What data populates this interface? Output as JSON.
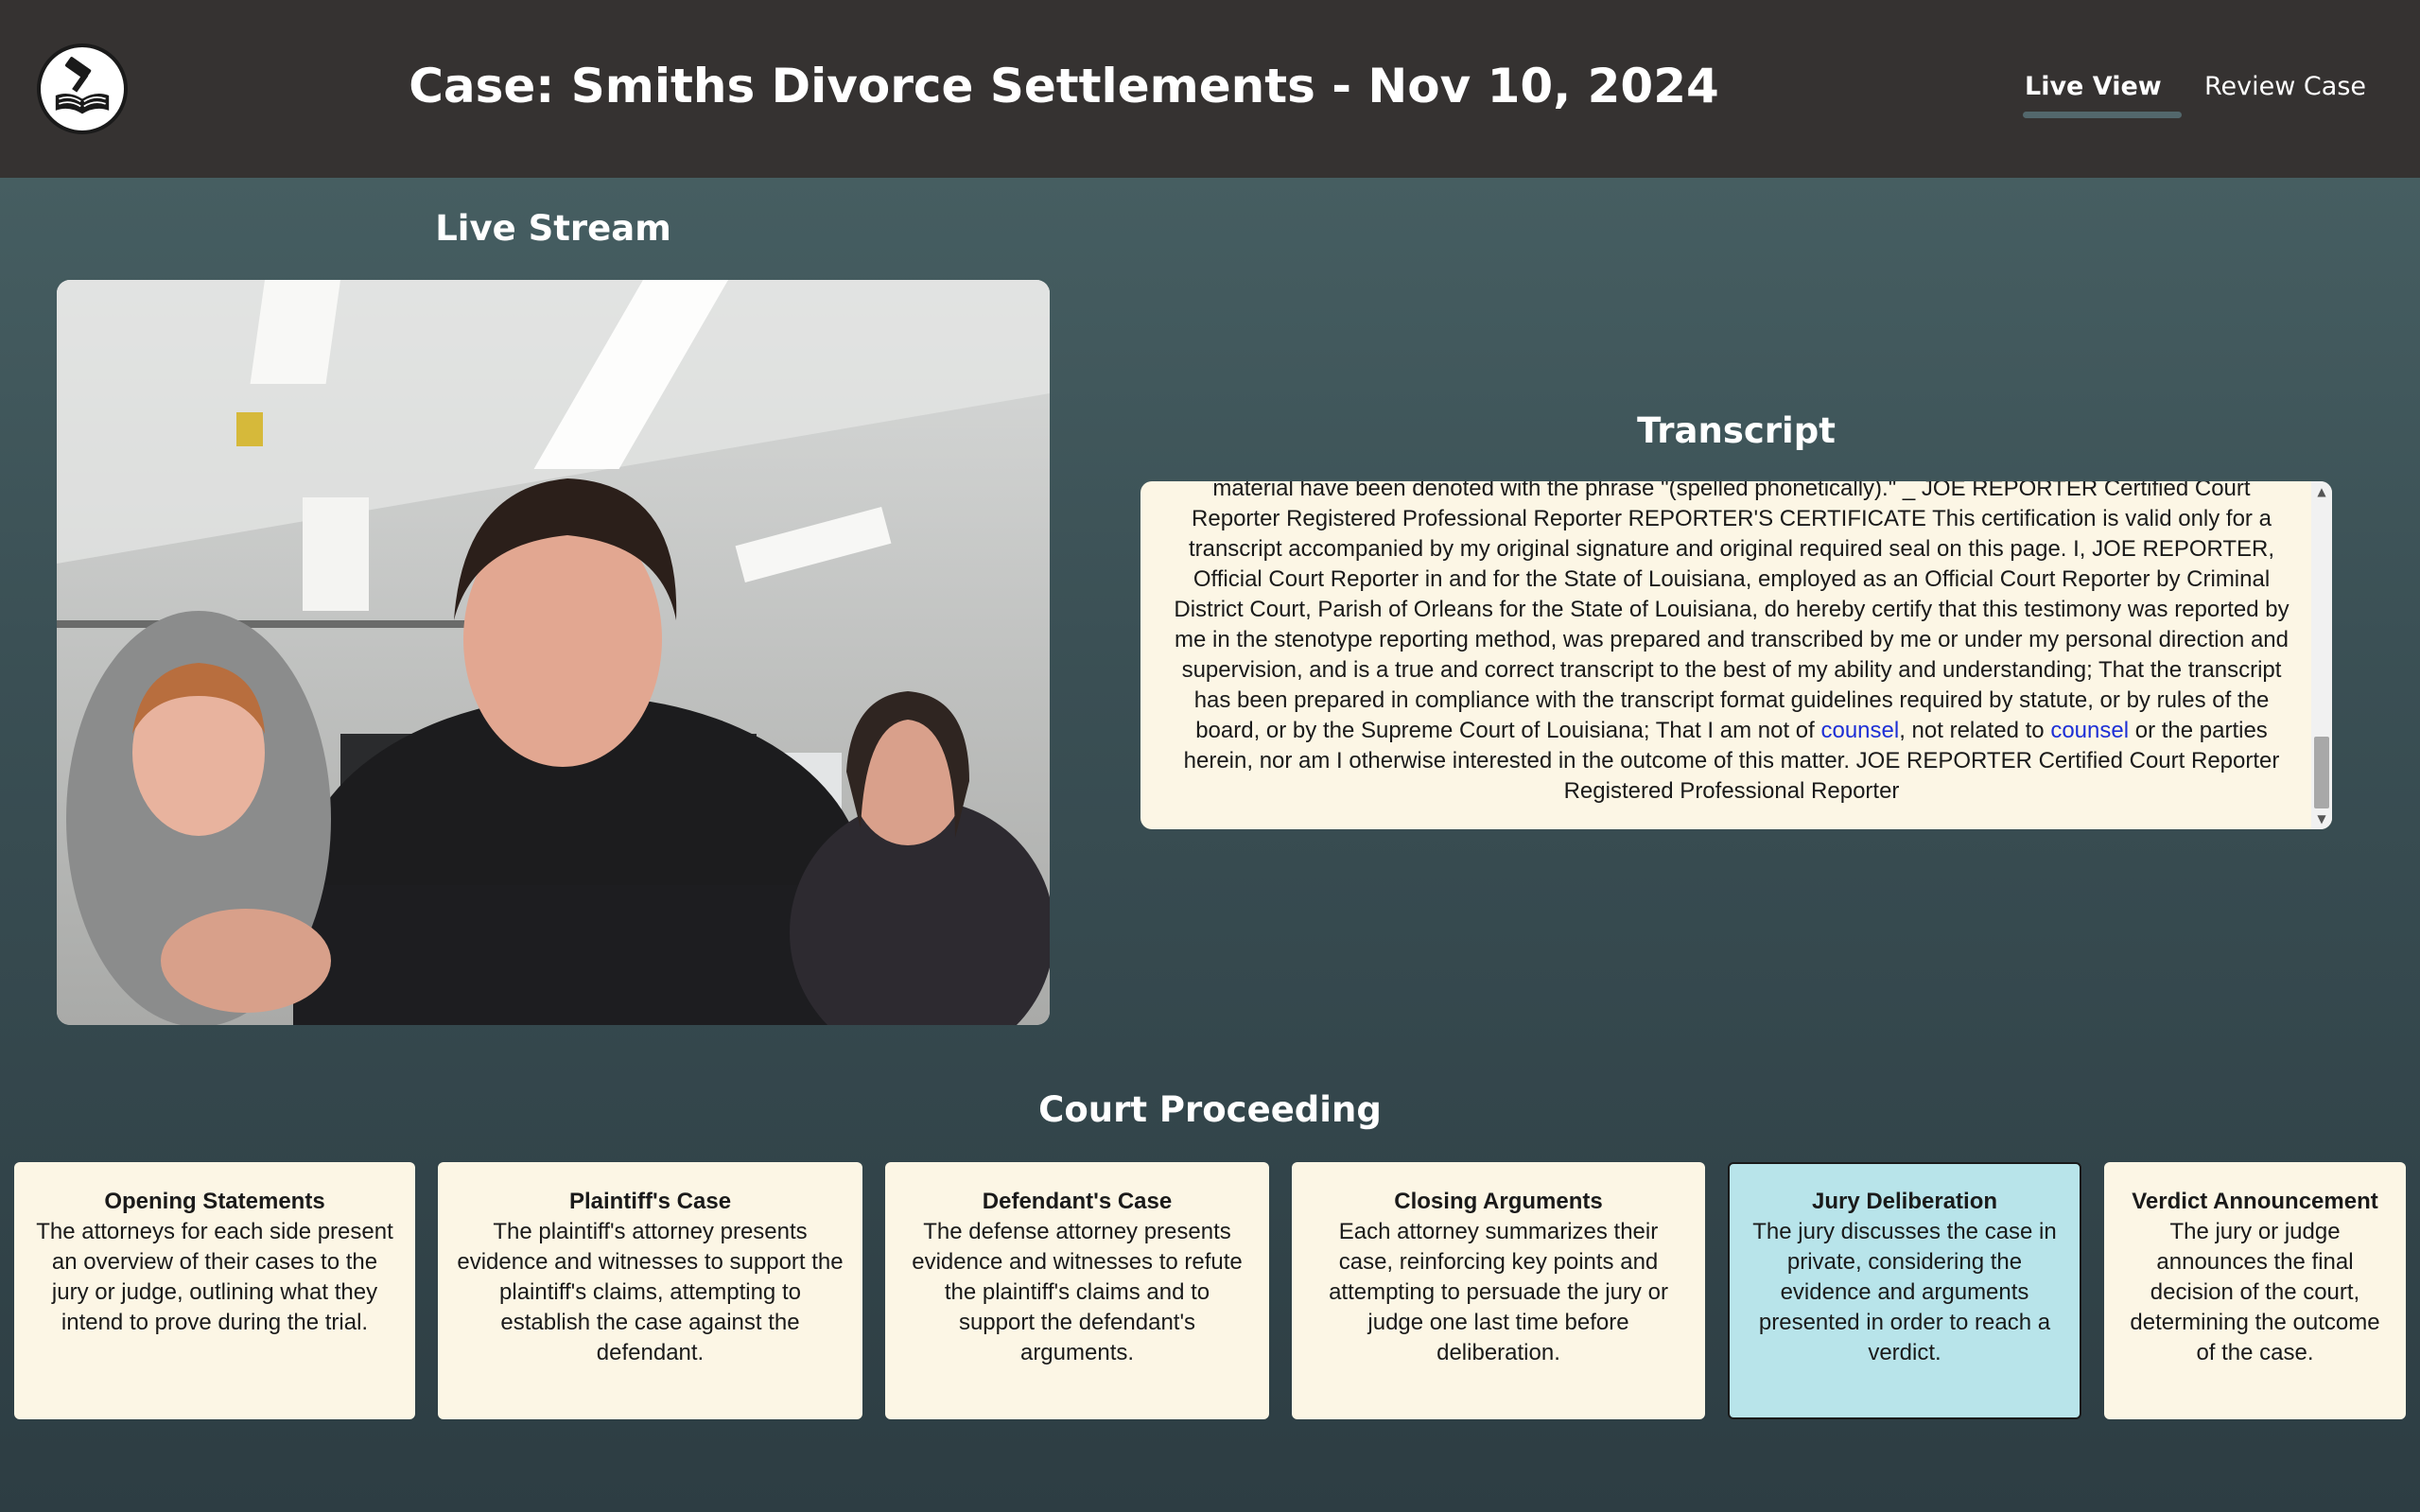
{
  "header": {
    "title": "Case: Smiths Divorce Settlements - Nov 10, 2024",
    "nav": {
      "live_view": "Live View",
      "review_case": "Review Case"
    }
  },
  "live_stream": {
    "heading": "Live Stream"
  },
  "transcript": {
    "heading": "Transcript",
    "parts": [
      "material have been denoted with the phrase \"(spelled phonetically).\" _ JOE REPORTER Certified Court Reporter Registered Professional Reporter REPORTER'S CERTIFICATE This certification is valid only for a transcript accompanied by my original signature and original required seal on this page. I, JOE REPORTER, Official Court Reporter in and for the State of Louisiana, employed as an Official Court Reporter by Criminal District Court, Parish of Orleans for the State of Louisiana, do hereby certify that this testimony was reported by me in the stenotype reporting method, was prepared and transcribed by me or under my personal direction and supervision, and is a true and correct transcript to the best of my ability and understanding; That the transcript has been prepared in compliance with the transcript format guidelines required by statute, or by rules of the board, or by the Supreme Court of Louisiana; That I am not of ",
      "counsel",
      ", not related to ",
      "counsel",
      " or the parties herein, nor am I otherwise interested in the outcome of this matter. JOE REPORTER Certified Court Reporter Registered Professional Reporter"
    ]
  },
  "court_proceeding": {
    "heading": "Court Proceeding",
    "active_stage": "Jury Deliberation",
    "active_color": "#b8e4ea",
    "stages": [
      {
        "title": "Opening Statements",
        "description": "The attorneys for each side present an overview of their cases to the jury or judge, outlining what they intend to prove during the trial."
      },
      {
        "title": "Plaintiff's Case",
        "description": "The plaintiff's attorney presents evidence and witnesses to support the plaintiff's claims, attempting to establish the case against the defendant."
      },
      {
        "title": "Defendant's Case",
        "description": "The defense attorney presents evidence and witnesses to refute the plaintiff's claims and to support the defendant's arguments."
      },
      {
        "title": "Closing Arguments",
        "description": "Each attorney summarizes their case, reinforcing key points and attempting to persuade the jury or judge one last time before deliberation."
      },
      {
        "title": "Jury Deliberation",
        "description": "The jury discusses the case in private, considering the evidence and arguments presented in order to reach a verdict."
      },
      {
        "title": "Verdict Announcement",
        "description": "The jury or judge announces the final decision of the court, determining the outcome of the case."
      }
    ]
  },
  "colors": {
    "header_bg": "#353231",
    "card_bg": "#fcf6e5",
    "link": "#1d2fd6"
  }
}
